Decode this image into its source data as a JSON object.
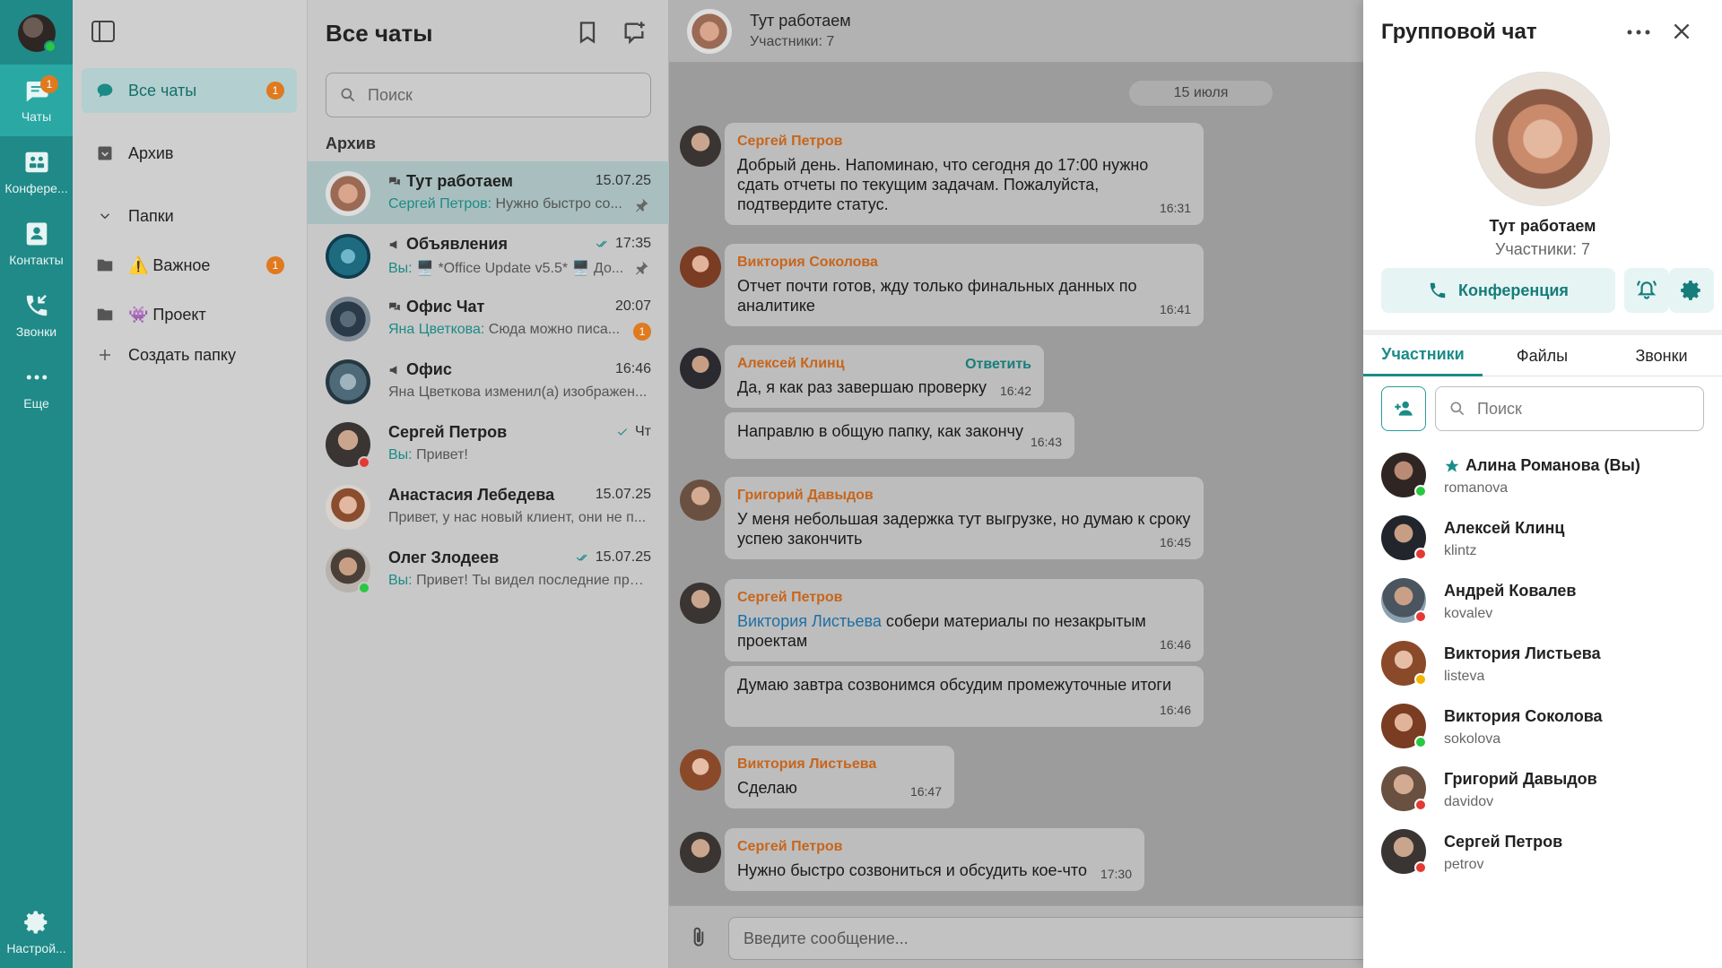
{
  "rail": {
    "items": [
      {
        "label": "Чаты",
        "badge": "1"
      },
      {
        "label": "Конфере..."
      },
      {
        "label": "Контакты"
      },
      {
        "label": "Звонки"
      },
      {
        "label": "Еще"
      }
    ],
    "settings_label": "Настрой..."
  },
  "folders": {
    "all_chats": {
      "label": "Все чаты",
      "badge": "1"
    },
    "archive": "Архив",
    "folders_header": "Папки",
    "important": {
      "label": "⚠️ Важное",
      "badge": "1"
    },
    "project": "👾 Проект",
    "create": "Создать папку"
  },
  "chatlist": {
    "title": "Все чаты",
    "search_placeholder": "Поиск",
    "archive_label": "Архив",
    "chats": [
      {
        "name": "Тут работаем",
        "time": "15.07.25",
        "who": "Сергей Петров:",
        "text": " Нужно быстро со...",
        "pinned": true
      },
      {
        "name": "Объявления",
        "time": "17:35",
        "who": "Вы:",
        "text": " 🖥️ *Office Update v5.5* 🖥️ До...",
        "pinned": true
      },
      {
        "name": "Офис Чат",
        "time": "20:07",
        "who": "Яна Цветкова:",
        "text": " Сюда можно писа...",
        "unread": "1"
      },
      {
        "name": "Офис",
        "time": "16:46",
        "who": "",
        "text": "Яна Цветкова изменил(а) изображен..."
      },
      {
        "name": "Сергей Петров",
        "time": "Чт",
        "who": "Вы:",
        "text": " Привет!"
      },
      {
        "name": "Анастасия Лебедева",
        "time": "15.07.25",
        "who": "",
        "text": "Привет, у нас новый клиент, они не п..."
      },
      {
        "name": "Олег Злодеев",
        "time": "15.07.25",
        "who": "Вы:",
        "text": " Привет! Ты видел последние пра..."
      }
    ]
  },
  "conversation": {
    "title": "Тут работаем",
    "subtitle": "Участники: 7",
    "date": "15 июля",
    "reply_label": "Ответить",
    "messages": [
      {
        "author": "Сергей Петров",
        "text": "Добрый день. Напоминаю, что сегодня до 17:00 нужно сдать отчеты по текущим задачам. Пожалуйста, подтвердите статус.",
        "time": "16:31"
      },
      {
        "author": "Виктория Соколова",
        "text": "Отчет почти готов, жду только финальных данных по аналитике",
        "time": "16:41"
      },
      {
        "author": "Алексей Клинц",
        "text": "Да, я как раз завершаю проверку",
        "time": "16:42"
      },
      {
        "author": "",
        "text": "Направлю в общую папку, как закончу",
        "time": "16:43"
      },
      {
        "author": "Григорий Давыдов",
        "text": "У меня небольшая задержка тут выгрузке, но думаю к сроку успею закончить",
        "time": "16:45"
      },
      {
        "author": "Сергей Петров",
        "mention": "Виктория Листьева",
        "text": " собери материалы по незакрытым проектам",
        "time": "16:46"
      },
      {
        "author": "",
        "text": "Думаю завтра созвонимся обсудим промежуточные итоги",
        "time": "16:46"
      },
      {
        "author": "Виктория Листьева",
        "text": "Сделаю",
        "time": "16:47"
      },
      {
        "author": "Сергей Петров",
        "text": "Нужно быстро созвониться и обсудить кое-что",
        "time": "17:30"
      }
    ],
    "composer_placeholder": "Введите сообщение..."
  },
  "info": {
    "title": "Групповой чат",
    "group_name": "Тут работаем",
    "group_count": "Участники: 7",
    "conference_label": "Конференция",
    "tabs": [
      "Участники",
      "Файлы",
      "Звонки"
    ],
    "search_placeholder": "Поиск",
    "members": [
      {
        "name": "Алина Романова (Вы)",
        "login": "romanova",
        "status": "online",
        "starred": true
      },
      {
        "name": "Алексей Клинц",
        "login": "klintz",
        "status": "busy"
      },
      {
        "name": "Андрей Ковалев",
        "login": "kovalev",
        "status": "busy"
      },
      {
        "name": "Виктория Листьева",
        "login": "listeva",
        "status": "away"
      },
      {
        "name": "Виктория Соколова",
        "login": "sokolova",
        "status": "online"
      },
      {
        "name": "Григорий Давыдов",
        "login": "davidov",
        "status": "busy"
      },
      {
        "name": "Сергей Петров",
        "login": "petrov",
        "status": "busy"
      }
    ]
  },
  "colors": {
    "accent": "#1f8a88",
    "badge": "#e07a1e",
    "online": "#28c840",
    "busy": "#e53935",
    "away": "#f5b400",
    "author": "#c8651b"
  }
}
